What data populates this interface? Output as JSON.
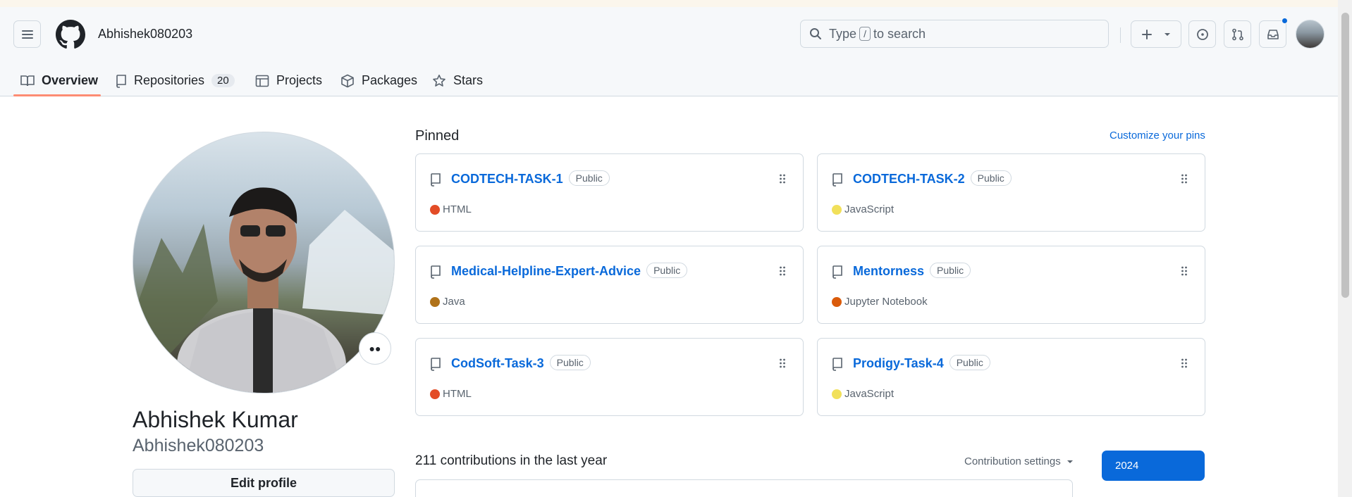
{
  "header": {
    "username": "Abhishek080203",
    "search_prefix": "Type",
    "search_key": "/",
    "search_suffix": "to search"
  },
  "tabs": [
    {
      "label": "Overview",
      "icon": "book-icon",
      "active": true
    },
    {
      "label": "Repositories",
      "icon": "repo-icon",
      "count": "20"
    },
    {
      "label": "Projects",
      "icon": "table-icon"
    },
    {
      "label": "Packages",
      "icon": "package-icon"
    },
    {
      "label": "Stars",
      "icon": "star-icon"
    }
  ],
  "profile": {
    "full_name": "Abhishek Kumar",
    "login": "Abhishek080203",
    "edit_label": "Edit profile"
  },
  "pinned": {
    "title": "Pinned",
    "customize_label": "Customize your pins",
    "repos": [
      {
        "name": "CODTECH-TASK-1",
        "visibility": "Public",
        "language": "HTML",
        "color": "#e34c26"
      },
      {
        "name": "CODTECH-TASK-2",
        "visibility": "Public",
        "language": "JavaScript",
        "color": "#f1e05a"
      },
      {
        "name": "Medical-Helpline-Expert-Advice",
        "visibility": "Public",
        "language": "Java",
        "color": "#b07219"
      },
      {
        "name": "Mentorness",
        "visibility": "Public",
        "language": "Jupyter Notebook",
        "color": "#da5b0b"
      },
      {
        "name": "CodSoft-Task-3",
        "visibility": "Public",
        "language": "HTML",
        "color": "#e34c26"
      },
      {
        "name": "Prodigy-Task-4",
        "visibility": "Public",
        "language": "JavaScript",
        "color": "#f1e05a"
      }
    ]
  },
  "contributions": {
    "title": "211 contributions in the last year",
    "settings_label": "Contribution settings",
    "year": "2024"
  },
  "colors": {
    "accent": "#0969da",
    "tab_underline": "#fd8c73"
  }
}
